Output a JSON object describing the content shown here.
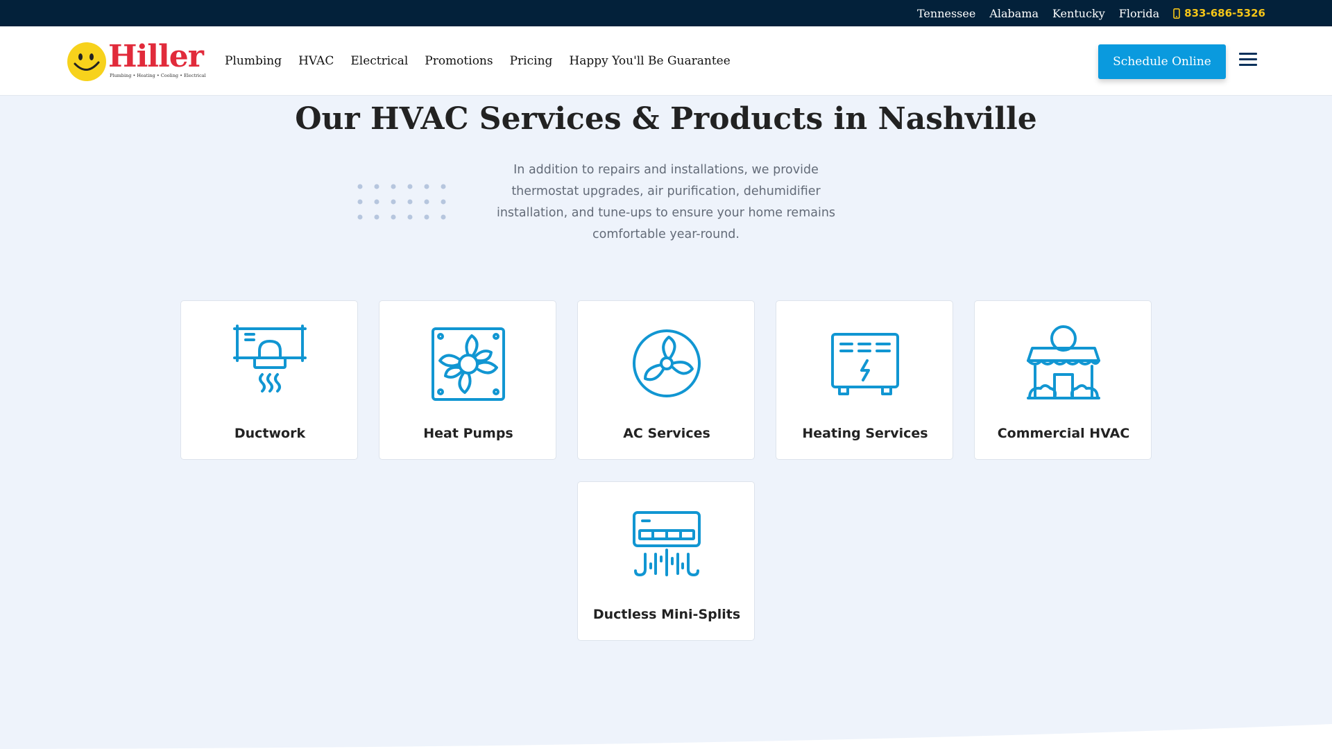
{
  "topbar": {
    "states": [
      "Tennessee",
      "Alabama",
      "Kentucky",
      "Florida"
    ],
    "phone": "833-686-5326",
    "phone_color": "#f5c518",
    "background": "#03213a"
  },
  "header": {
    "logo": {
      "brand": "Hiller",
      "tagline": "Plumbing • Heating • Cooling • Electrical"
    },
    "nav": [
      "Plumbing",
      "HVAC",
      "Electrical",
      "Promotions",
      "Pricing",
      "Happy You'll Be Guarantee"
    ],
    "cta_label": "Schedule Online",
    "cta_color": "#0a9ade"
  },
  "section": {
    "title": "Our HVAC Services & Products in Nashville",
    "description": "In addition to repairs and installations, we provide thermostat upgrades, air purification, dehumidifier installation, and tune-ups to ensure your home remains comfortable year-round."
  },
  "services": [
    {
      "label": "Ductwork",
      "icon": "ductwork-icon"
    },
    {
      "label": "Heat Pumps",
      "icon": "heat-pump-icon"
    },
    {
      "label": "AC Services",
      "icon": "ac-fan-icon"
    },
    {
      "label": "Heating Services",
      "icon": "heater-icon"
    },
    {
      "label": "Commercial HVAC",
      "icon": "commercial-building-icon"
    },
    {
      "label": "Ductless Mini-Splits",
      "icon": "mini-split-icon"
    }
  ],
  "icon_color": "#1196d2"
}
